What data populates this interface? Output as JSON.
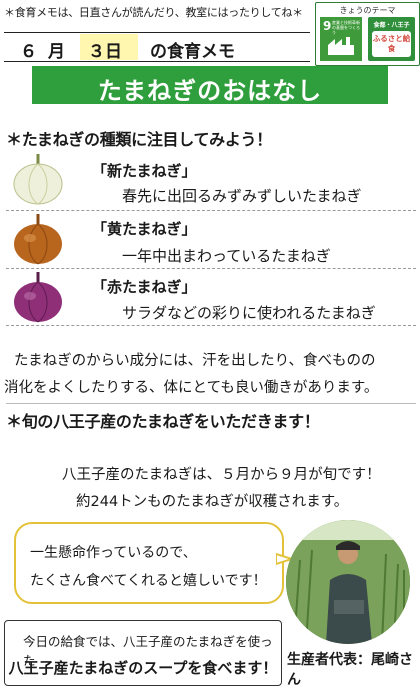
{
  "header": {
    "top_note": "＊食育メモは、日直さんが読んだり、教室にはったりしてね＊",
    "month": "６",
    "month_unit": "月",
    "day": "３日",
    "title_suffix": "の食育メモ",
    "theme_label": "きょうのテーマ",
    "sdg_number": "9",
    "sdg_caption": "産業と技術革新の基盤をつくろう",
    "badge_line1": "食都・八王子",
    "badge_line2": "ふるさと給食"
  },
  "banner": {
    "title": "たまねぎのおはなし"
  },
  "section1": {
    "heading": "＊たまねぎの種類に注目してみよう！",
    "onions": [
      {
        "name": "「新たまねぎ」",
        "desc": "春先に出回るみずみずしいたまねぎ",
        "color": "#e8ecd6"
      },
      {
        "name": "「黄たまねぎ」",
        "desc": "一年中出まわっているたまねぎ",
        "color": "#b8651e"
      },
      {
        "name": "「赤たまねぎ」",
        "desc": "サラダなどの彩りに使われるたまねぎ",
        "color": "#8e2f78"
      }
    ],
    "para_line1": "たまねぎのからい成分には、汗を出したり、食べものの",
    "para_line2": "消化をよくしたりする、体にとても良い働きがあります。"
  },
  "section2": {
    "heading": "＊旬の八王子産のたまねぎをいただきます！",
    "line1": "八王子産のたまねぎは、５月から９月が旬です！",
    "line2": "約244トンものたまねぎが収穫されます。"
  },
  "bubble": {
    "line1": "一生懸命作っているので、",
    "line2": "たくさん食べてくれると嬉しいです！"
  },
  "bottom": {
    "line1": "今日の給食では、八王子産のたまねぎを使った",
    "line2": "八王子産たまねぎのスープを食べます！"
  },
  "producer": {
    "label": "生産者代表：尾崎さん"
  },
  "colors": {
    "banner": "#2f9e3c",
    "day_highlight": "#fff7b0",
    "bubble_border": "#e3c23a"
  }
}
